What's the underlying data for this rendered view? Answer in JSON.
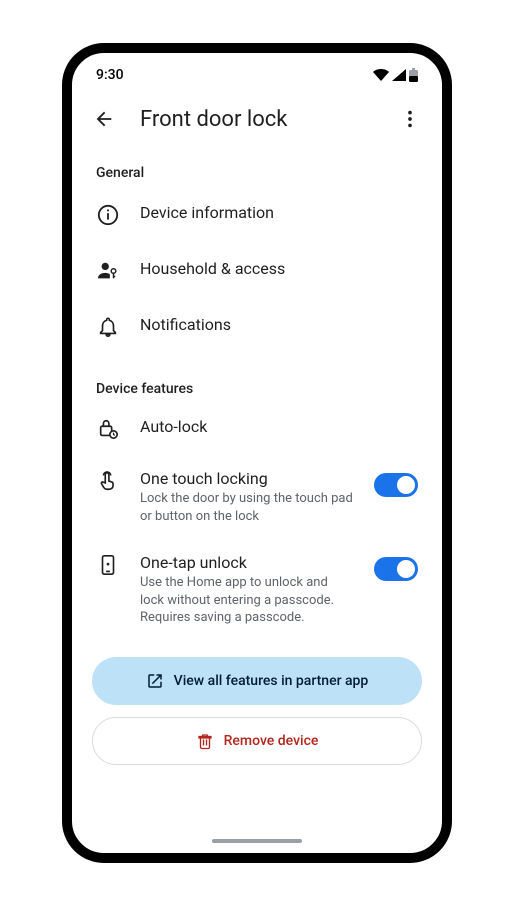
{
  "status_bar": {
    "time": "9:30"
  },
  "header": {
    "title": "Front door lock"
  },
  "sections": {
    "general": {
      "label": "General",
      "items": {
        "device_info": "Device information",
        "household": "Household & access",
        "notifications": "Notifications"
      }
    },
    "device_features": {
      "label": "Device features",
      "items": {
        "auto_lock": {
          "title": "Auto-lock"
        },
        "one_touch": {
          "title": "One touch locking",
          "subtitle": "Lock the door by using the touch pad or button on the lock"
        },
        "one_tap": {
          "title": "One-tap unlock",
          "subtitle": "Use the Home app to unlock and lock without entering a passcode. Requires saving a passcode."
        }
      }
    }
  },
  "buttons": {
    "partner_app": "View all features in partner app",
    "remove": "Remove device"
  }
}
